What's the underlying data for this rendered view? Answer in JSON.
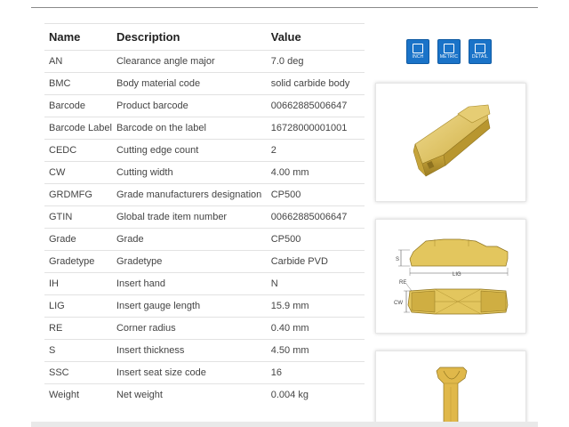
{
  "table": {
    "headers": [
      "Name",
      "Description",
      "Value"
    ],
    "rows": [
      [
        "AN",
        "Clearance angle major",
        "7.0 deg"
      ],
      [
        "BMC",
        "Body material code",
        "solid carbide body"
      ],
      [
        "Barcode",
        "Product barcode",
        "00662885006647"
      ],
      [
        "Barcode Label",
        "Barcode on the label",
        "16728000001001"
      ],
      [
        "CEDC",
        "Cutting edge count",
        "2"
      ],
      [
        "CW",
        "Cutting width",
        "4.00 mm"
      ],
      [
        "GRDMFG",
        "Grade manufacturers designation",
        "CP500"
      ],
      [
        "GTIN",
        "Global trade item number",
        "00662885006647"
      ],
      [
        "Grade",
        "Grade",
        "CP500"
      ],
      [
        "Gradetype",
        "Gradetype",
        "Carbide PVD"
      ],
      [
        "IH",
        "Insert hand",
        "N"
      ],
      [
        "LIG",
        "Insert gauge length",
        "15.9 mm"
      ],
      [
        "RE",
        "Corner radius",
        "0.40 mm"
      ],
      [
        "S",
        "Insert thickness",
        "4.50 mm"
      ],
      [
        "SSC",
        "Insert seat size code",
        "16"
      ],
      [
        "Weight",
        "Net weight",
        "0.004 kg"
      ]
    ]
  },
  "downloads": [
    {
      "label": "INCH",
      "icon": "drawing-file-icon"
    },
    {
      "label": "METRIC",
      "icon": "drawing-file-icon"
    },
    {
      "label": "DETAIL",
      "icon": "drawing-file-icon"
    }
  ],
  "drawing": {
    "dim_s": "S",
    "dim_lig": "LIG",
    "dim_re": "RE",
    "dim_cw": "CW"
  },
  "colors": {
    "accent": "#1a73c8",
    "insert_gold": "#d9b94a",
    "insert_gold_light": "#ecd78a",
    "insert_gold_dark": "#a88a2a"
  }
}
